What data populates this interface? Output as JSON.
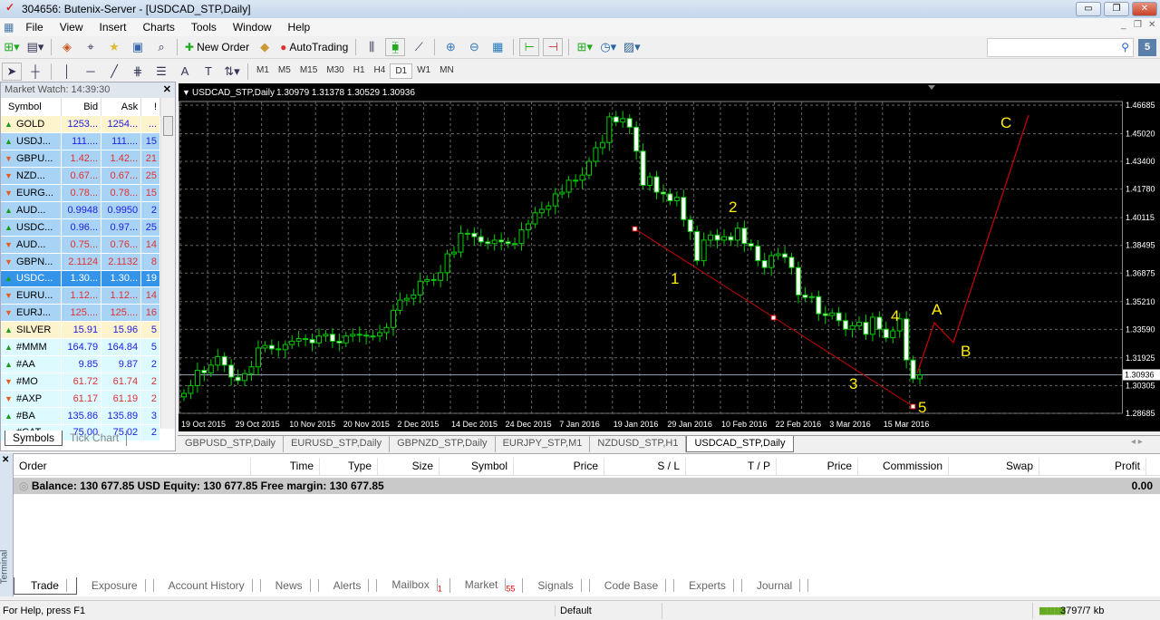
{
  "window": {
    "title": "304656: Butenix-Server - [USDCAD_STP,Daily]"
  },
  "menu": [
    "File",
    "View",
    "Insert",
    "Charts",
    "Tools",
    "Window",
    "Help"
  ],
  "toolbar": {
    "new_order": "New Order",
    "autotrading": "AutoTrading",
    "search_placeholder": "",
    "search_icon": "magnifier-icon",
    "notify_count": "5"
  },
  "timeframes": [
    "M1",
    "M5",
    "M15",
    "M30",
    "H1",
    "H4",
    "D1",
    "W1",
    "MN"
  ],
  "active_timeframe": "D1",
  "market_watch": {
    "title": "Market Watch: 14:39:30",
    "columns": [
      "Symbol",
      "Bid",
      "Ask",
      "!"
    ],
    "rows": [
      {
        "dir": "up",
        "symbol": "GOLD",
        "bid": "1253...",
        "ask": "1254...",
        "spread": "...",
        "cls": "metal",
        "color": "blue"
      },
      {
        "dir": "up",
        "symbol": "USDJ...",
        "bid": "111....",
        "ask": "111....",
        "spread": "15",
        "cls": "fx",
        "color": "blue"
      },
      {
        "dir": "dn",
        "symbol": "GBPU...",
        "bid": "1.42...",
        "ask": "1.42...",
        "spread": "21",
        "cls": "fx",
        "color": "red"
      },
      {
        "dir": "dn",
        "symbol": "NZD...",
        "bid": "0.67...",
        "ask": "0.67...",
        "spread": "25",
        "cls": "fx",
        "color": "red"
      },
      {
        "dir": "dn",
        "symbol": "EURG...",
        "bid": "0.78...",
        "ask": "0.78...",
        "spread": "15",
        "cls": "fx",
        "color": "red"
      },
      {
        "dir": "up",
        "symbol": "AUD...",
        "bid": "0.9948",
        "ask": "0.9950",
        "spread": "2",
        "cls": "fx",
        "color": "blue"
      },
      {
        "dir": "up",
        "symbol": "USDC...",
        "bid": "0.96...",
        "ask": "0.97...",
        "spread": "25",
        "cls": "fx",
        "color": "blue"
      },
      {
        "dir": "dn",
        "symbol": "AUD...",
        "bid": "0.75...",
        "ask": "0.76...",
        "spread": "14",
        "cls": "fx",
        "color": "red"
      },
      {
        "dir": "dn",
        "symbol": "GBPN...",
        "bid": "2.1124",
        "ask": "2.1132",
        "spread": "8",
        "cls": "fx",
        "color": "red"
      },
      {
        "dir": "up",
        "symbol": "USDC...",
        "bid": "1.30...",
        "ask": "1.30...",
        "spread": "19",
        "cls": "sel",
        "color": "white"
      },
      {
        "dir": "dn",
        "symbol": "EURU...",
        "bid": "1.12...",
        "ask": "1.12...",
        "spread": "14",
        "cls": "fx",
        "color": "red"
      },
      {
        "dir": "dn",
        "symbol": "EURJ...",
        "bid": "125....",
        "ask": "125....",
        "spread": "16",
        "cls": "fx",
        "color": "red"
      },
      {
        "dir": "up",
        "symbol": "SILVER",
        "bid": "15.91",
        "ask": "15.96",
        "spread": "5",
        "cls": "metal",
        "color": "blue"
      },
      {
        "dir": "up",
        "symbol": "#MMM",
        "bid": "164.79",
        "ask": "164.84",
        "spread": "5",
        "cls": "stock",
        "color": "blue"
      },
      {
        "dir": "up",
        "symbol": "#AA",
        "bid": "9.85",
        "ask": "9.87",
        "spread": "2",
        "cls": "stock",
        "color": "blue"
      },
      {
        "dir": "dn",
        "symbol": "#MO",
        "bid": "61.72",
        "ask": "61.74",
        "spread": "2",
        "cls": "stock",
        "color": "red"
      },
      {
        "dir": "dn",
        "symbol": "#AXP",
        "bid": "61.17",
        "ask": "61.19",
        "spread": "2",
        "cls": "stock",
        "color": "red"
      },
      {
        "dir": "up",
        "symbol": "#BA",
        "bid": "135.86",
        "ask": "135.89",
        "spread": "3",
        "cls": "stock",
        "color": "blue"
      },
      {
        "dir": "up",
        "symbol": "#CAT",
        "bid": "75.00",
        "ask": "75.02",
        "spread": "2",
        "cls": "stock",
        "color": "blue"
      }
    ],
    "tabs": [
      "Symbols",
      "Tick Chart"
    ]
  },
  "chart_tabs": [
    "GBPUSD_STP,Daily",
    "EURUSD_STP,Daily",
    "GBPNZD_STP,Daily",
    "EURJPY_STP,M1",
    "NZDUSD_STP,H1",
    "USDCAD_STP,Daily"
  ],
  "active_chart_tab": "USDCAD_STP,Daily",
  "chart_data": {
    "type": "candlestick",
    "title": "USDCAD_STP,Daily",
    "ohlc_header": "1.30979 1.31378 1.30529 1.30936",
    "current_price": "1.30936",
    "ylim": [
      1.28685,
      1.46685
    ],
    "y_ticks": [
      "1.46685",
      "1.45020",
      "1.43400",
      "1.41780",
      "1.40115",
      "1.38495",
      "1.36875",
      "1.35210",
      "1.33590",
      "1.31925",
      "1.30305",
      "1.28685"
    ],
    "x_ticks": [
      "19 Oct 2015",
      "29 Oct 2015",
      "10 Nov 2015",
      "20 Nov 2015",
      "2 Dec 2015",
      "14 Dec 2015",
      "24 Dec 2015",
      "7 Jan 2016",
      "19 Jan 2016",
      "29 Jan 2016",
      "10 Feb 2016",
      "22 Feb 2016",
      "3 Mar 2016",
      "15 Mar 2016"
    ],
    "grid": true,
    "bull_color": "#00cc00",
    "bear_color": "#ffffff",
    "background": "#000000",
    "closes": [
      1.2985,
      1.303,
      1.312,
      1.3105,
      1.315,
      1.32,
      1.315,
      1.308,
      1.306,
      1.31,
      1.314,
      1.325,
      1.3265,
      1.3245,
      1.324,
      1.327,
      1.329,
      1.3305,
      1.33,
      1.328,
      1.332,
      1.333,
      1.329,
      1.328,
      1.332,
      1.333,
      1.3325,
      1.332,
      1.332,
      1.334,
      1.337,
      1.347,
      1.353,
      1.354,
      1.356,
      1.364,
      1.365,
      1.3645,
      1.369,
      1.38,
      1.381,
      1.392,
      1.392,
      1.39,
      1.387,
      1.386,
      1.388,
      1.387,
      1.386,
      1.386,
      1.394,
      1.3975,
      1.404,
      1.406,
      1.408,
      1.415,
      1.416,
      1.423,
      1.423,
      1.426,
      1.434,
      1.442,
      1.445,
      1.46,
      1.457,
      1.459,
      1.454,
      1.44,
      1.42,
      1.425,
      1.416,
      1.415,
      1.411,
      1.413,
      1.4,
      1.393,
      1.376,
      1.388,
      1.391,
      1.388,
      1.39,
      1.388,
      1.395,
      1.386,
      1.3845,
      1.376,
      1.372,
      1.379,
      1.38,
      1.378,
      1.372,
      1.356,
      1.3545,
      1.355,
      1.345,
      1.344,
      1.3455,
      1.341,
      1.336,
      1.338,
      1.34,
      1.333,
      1.343,
      1.336,
      1.331,
      1.335,
      1.342,
      1.318,
      1.307,
      1.3093
    ],
    "wave_labels": [
      "1",
      "2",
      "3",
      "4",
      "5",
      "A",
      "B",
      "C"
    ],
    "annotation_color": "#ffee00",
    "trendline_color": "#cc0000"
  },
  "terminal": {
    "side_label": "Terminal",
    "columns": [
      "Order",
      "Time",
      "Type",
      "Size",
      "Symbol",
      "Price",
      "S / L",
      "T / P",
      "Price",
      "Commission",
      "Swap",
      "Profit"
    ],
    "balance": "Balance: 130 677.85 USD  Equity: 130 677.85  Free margin: 130 677.85",
    "profit": "0.00",
    "tabs": [
      {
        "label": "Trade"
      },
      {
        "label": "Exposure"
      },
      {
        "label": "Account History"
      },
      {
        "label": "News"
      },
      {
        "label": "Alerts"
      },
      {
        "label": "Mailbox",
        "badge": "1"
      },
      {
        "label": "Market",
        "badge": "55"
      },
      {
        "label": "Signals"
      },
      {
        "label": "Code Base"
      },
      {
        "label": "Experts"
      },
      {
        "label": "Journal"
      }
    ]
  },
  "status": {
    "help": "For Help, press F1",
    "profile": "Default",
    "traffic": "3797/7 kb"
  }
}
